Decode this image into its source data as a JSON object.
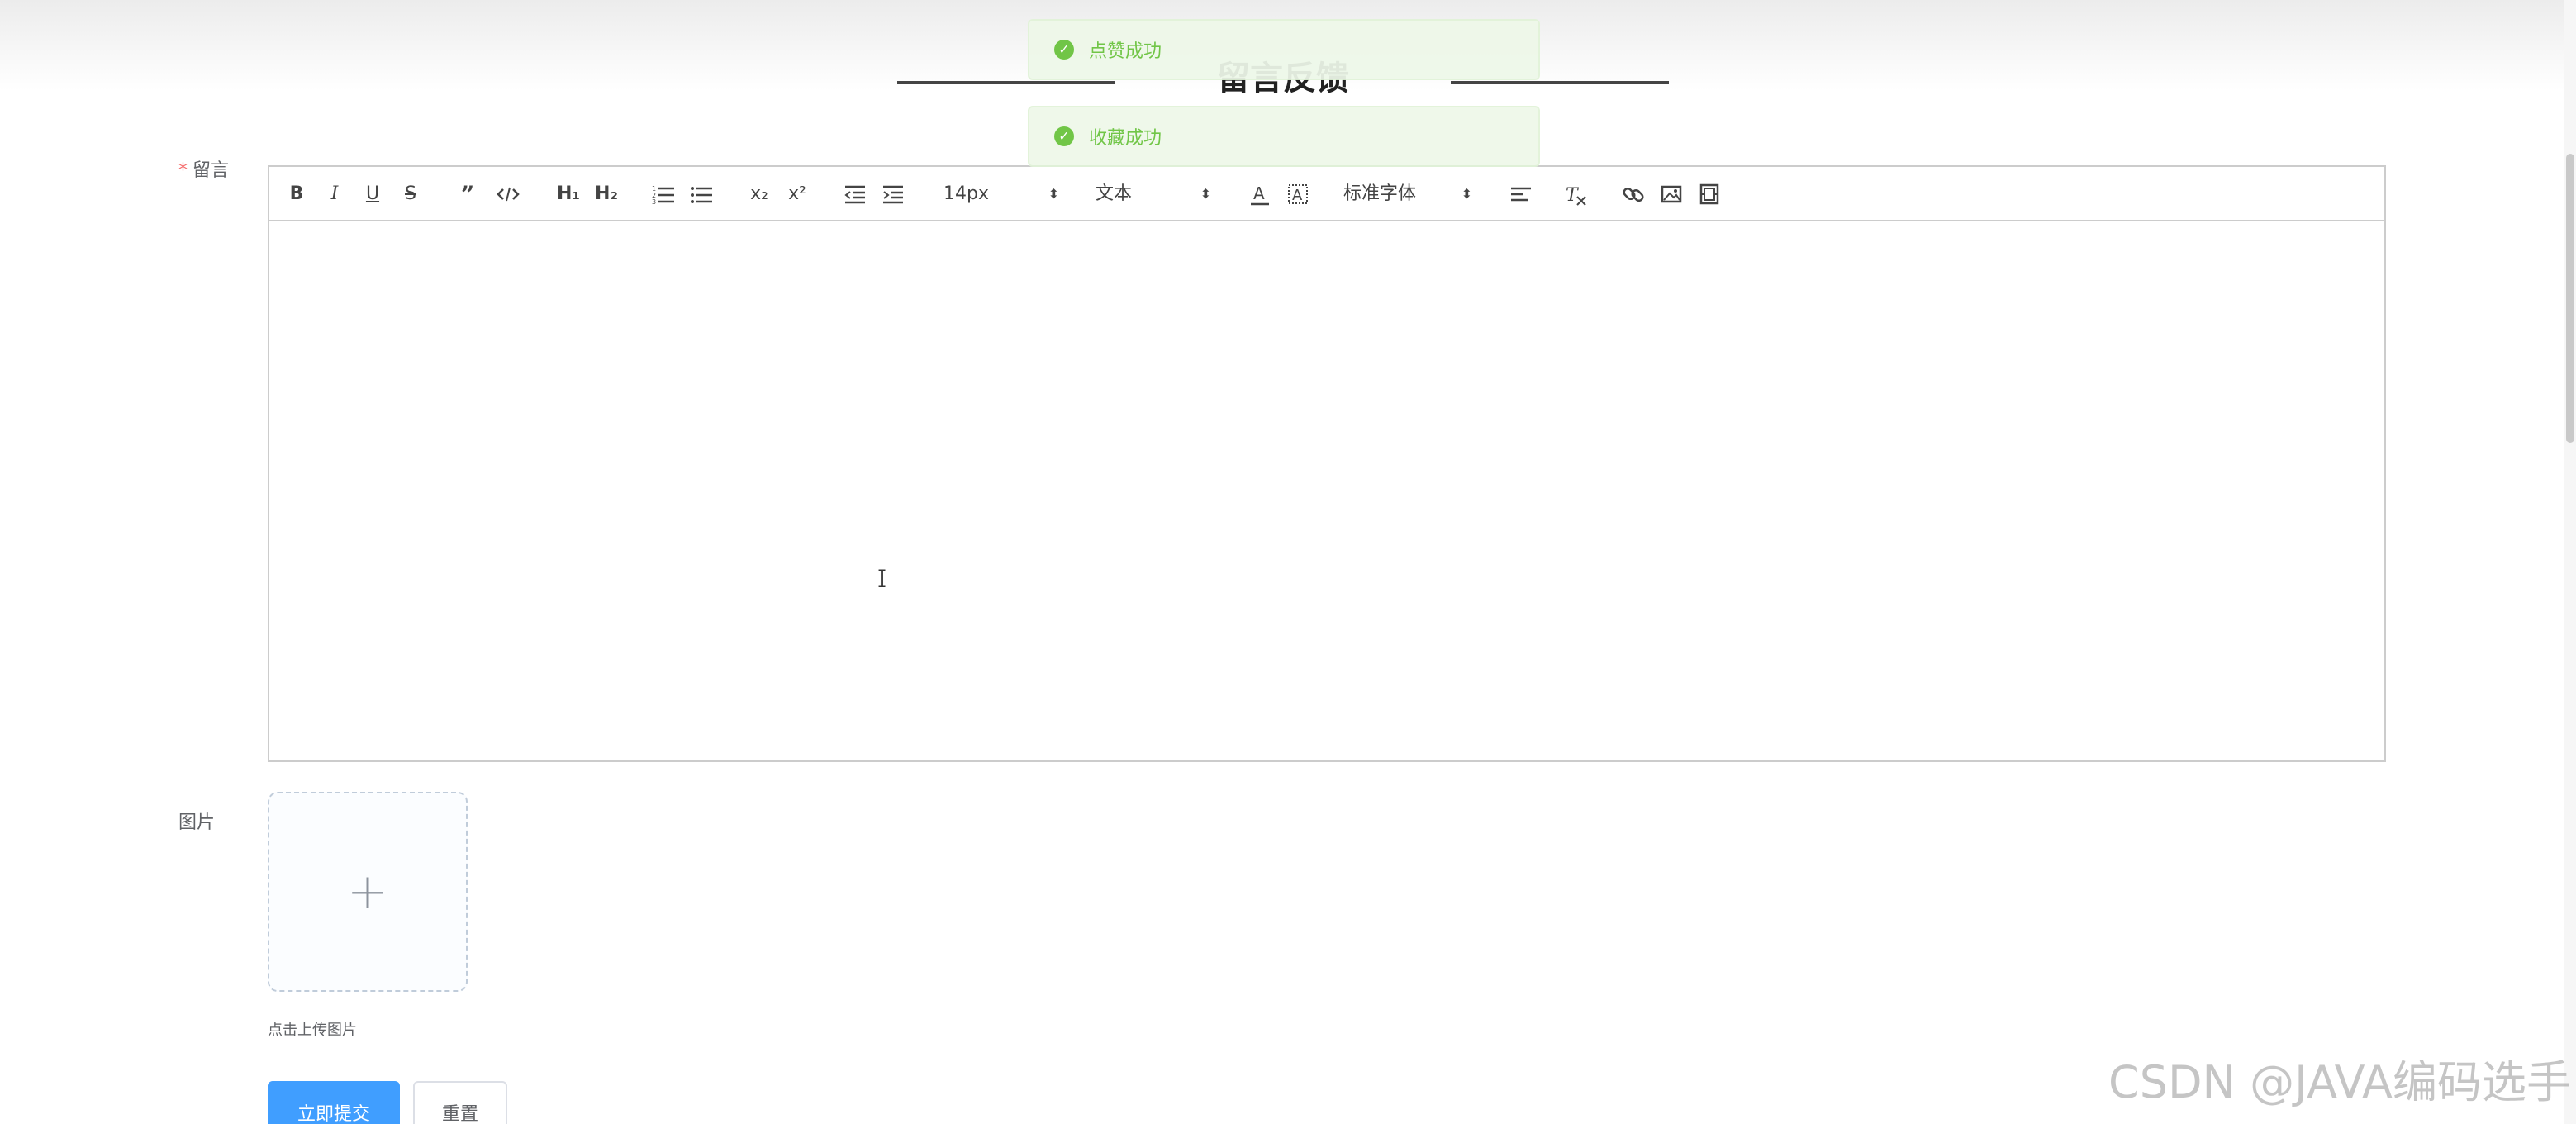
{
  "header": {
    "title": "留言反馈"
  },
  "toasts": [
    {
      "text": "点赞成功",
      "color": "#67c23a"
    },
    {
      "text": "收藏成功",
      "color": "#67c23a"
    }
  ],
  "form": {
    "message": {
      "required_mark": "*",
      "label": "留言"
    },
    "image": {
      "label": "图片",
      "upload_tip": "点击上传图片"
    }
  },
  "toolbar": {
    "buttons": {
      "bold": "B",
      "italic": "I",
      "underline": "U",
      "strike": "S",
      "h1": "H₁",
      "h2": "H₂",
      "sub": "x₂",
      "sup": "x²"
    },
    "font_size": "14px",
    "header_select": "文本",
    "font_family": "标准字体"
  },
  "actions": {
    "submit": "立即提交",
    "reset": "重置"
  },
  "watermark": "CSDN @JAVA编码选手"
}
